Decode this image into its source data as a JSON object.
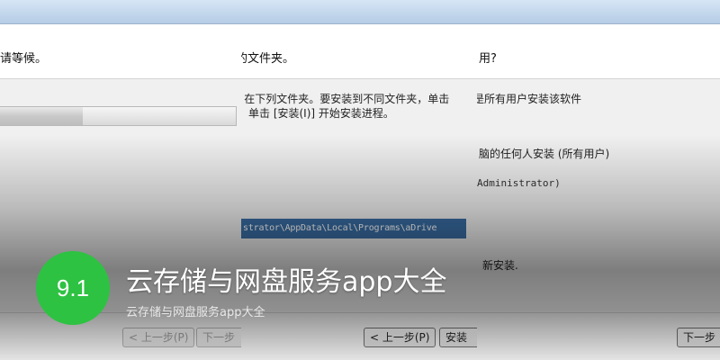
{
  "windows": [
    {
      "id": "w1",
      "header_text": "请等候。",
      "buttons": [
        {
          "label": "< 上一步(P)",
          "disabled": true
        },
        {
          "label": "下一步",
          "disabled": true
        }
      ]
    },
    {
      "id": "w2",
      "header_text": "的文件夹。",
      "desc_line1": "e 在下列文件夹。要安装到不同文件夹，单击",
      "desc_line2": "单击 [安装(I)] 开始安装进程。",
      "path_value": "strator\\AppData\\Local\\Programs\\aDrive",
      "buttons": [
        {
          "label": "< 上一步(P)",
          "disabled": false
        },
        {
          "label": "安装",
          "disabled": false
        }
      ]
    },
    {
      "id": "w3",
      "header_text": "用?",
      "desc_line1": "是所有用户安装该软件",
      "option1_text": "脑的任何人安装 (所有用户)",
      "option2_text": "Administrator)",
      "footer_text": "新安装.",
      "buttons": [
        {
          "label": "下一步",
          "disabled": false
        }
      ]
    }
  ],
  "caption": {
    "score": "9.1",
    "title": "云存储与网盘服务app大全",
    "subtitle": "云存储与网盘服务app大全"
  },
  "colors": {
    "badge": "#2ec243",
    "path_selection": "#3a6ea5",
    "title_bar": "#c3d7ec"
  },
  "progress_fraction": 0.35
}
